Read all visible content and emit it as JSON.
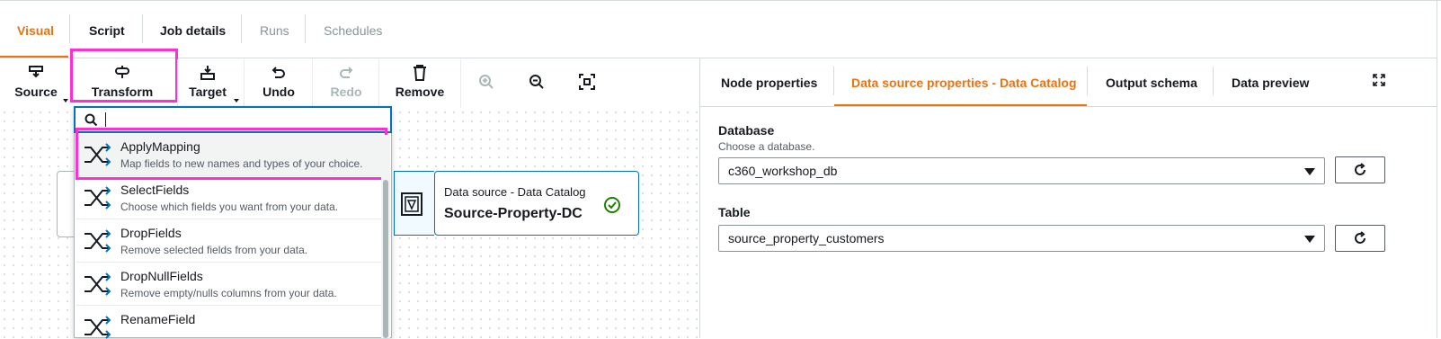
{
  "tabs": [
    {
      "label": "Visual",
      "state": "active"
    },
    {
      "label": "Script",
      "state": "enabled"
    },
    {
      "label": "Job details",
      "state": "enabled"
    },
    {
      "label": "Runs",
      "state": "disabled"
    },
    {
      "label": "Schedules",
      "state": "disabled"
    }
  ],
  "toolbar": {
    "source": "Source",
    "transform": "Transform",
    "target": "Target",
    "undo": "Undo",
    "redo": "Redo",
    "remove": "Remove"
  },
  "search": {
    "value": ""
  },
  "transforms": [
    {
      "title": "ApplyMapping",
      "desc": "Map fields to new names and types of your choice."
    },
    {
      "title": "SelectFields",
      "desc": "Choose which fields you want from your data."
    },
    {
      "title": "DropFields",
      "desc": "Remove selected fields from your data."
    },
    {
      "title": "DropNullFields",
      "desc": "Remove empty/nulls columns from your data."
    },
    {
      "title": "RenameField",
      "desc": ""
    }
  ],
  "node": {
    "type": "Data source - Data Catalog",
    "name": "Source-Property-DC"
  },
  "panel_tabs": [
    {
      "label": "Node properties",
      "state": "enabled"
    },
    {
      "label": "Data source properties - Data Catalog",
      "state": "active"
    },
    {
      "label": "Output schema",
      "state": "enabled"
    },
    {
      "label": "Data preview",
      "state": "enabled"
    }
  ],
  "database": {
    "label": "Database",
    "desc": "Choose a database.",
    "value": "c360_workshop_db"
  },
  "table": {
    "label": "Table",
    "value": "source_property_customers"
  },
  "colors": {
    "accent": "#ec7211",
    "link": "#0073bb",
    "highlight": "#ff2fd3",
    "disabled": "#879596",
    "success": "#1d8102"
  }
}
